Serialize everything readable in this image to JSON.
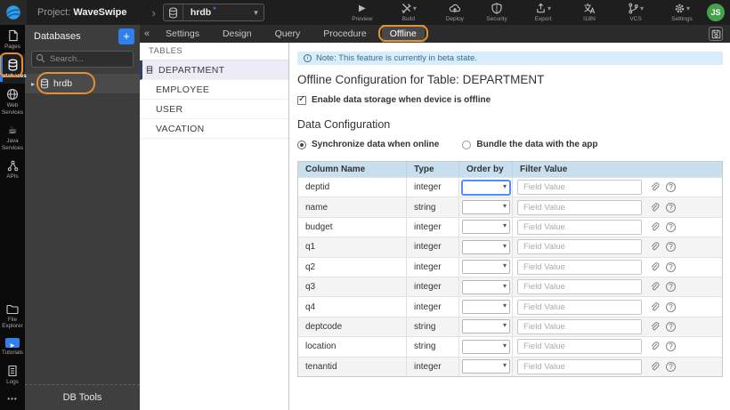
{
  "colors": {
    "accent_blue": "#2f80ed",
    "annotation_orange": "#e8902c",
    "note_bg": "#d9ecf9",
    "note_text": "#31708f",
    "table_header_bg": "#c8dff0",
    "avatar_green": "#46a24a",
    "active_tab_indicator": "#4a90e2"
  },
  "topbar": {
    "project_label": "Project:",
    "project_name": "WaveSwipe",
    "db_selector": {
      "value": "hrdb"
    },
    "actions_left": [
      {
        "label": "Preview",
        "icon": "play-icon"
      },
      {
        "label": "Build",
        "icon": "build-icon"
      },
      {
        "label": "Deploy",
        "icon": "deploy-icon"
      }
    ],
    "actions_right": [
      {
        "label": "Security",
        "icon": "shield-icon"
      },
      {
        "label": "Export",
        "icon": "export-icon"
      },
      {
        "label": "I18N",
        "icon": "translate-icon"
      },
      {
        "label": "VCS",
        "icon": "branch-icon"
      },
      {
        "label": "Settings",
        "icon": "gear-icon"
      }
    ],
    "avatar_initials": "JS"
  },
  "sidebar": {
    "top": [
      {
        "label": "Pages",
        "icon": "page-icon"
      },
      {
        "label": "Databases",
        "icon": "database-icon",
        "active": true
      },
      {
        "label": "Web Services",
        "icon": "globe-icon"
      },
      {
        "label": "Java Services",
        "icon": "coffee-icon"
      },
      {
        "label": "APIs",
        "icon": "api-icon"
      }
    ],
    "bottom": [
      {
        "label": "File Explorer",
        "icon": "folder-icon"
      },
      {
        "label": "Tutorials",
        "icon": "video-play-icon"
      },
      {
        "label": "Logs",
        "icon": "log-icon"
      }
    ]
  },
  "db_panel": {
    "title": "Databases",
    "search_placeholder": "Search...",
    "tree_items": [
      {
        "label": "hrdb"
      }
    ],
    "footer": "DB Tools"
  },
  "tabs": [
    {
      "label": "Settings"
    },
    {
      "label": "Design"
    },
    {
      "label": "Query"
    },
    {
      "label": "Procedure"
    },
    {
      "label": "Offline",
      "active": true
    }
  ],
  "tables_panel": {
    "header": "TABLES",
    "items": [
      "DEPARTMENT",
      "EMPLOYEE",
      "USER",
      "VACATION"
    ],
    "selected": "DEPARTMENT"
  },
  "main": {
    "note": "Note: This feature is currently in beta state.",
    "title": "Offline Configuration for Table: DEPARTMENT",
    "enable_checkbox_label": "Enable data storage when device is offline",
    "enable_checkbox_checked": true,
    "section_title": "Data Configuration",
    "radio_options": [
      {
        "label": "Synchronize data when online",
        "selected": true
      },
      {
        "label": "Bundle the data with the app",
        "selected": false
      }
    ],
    "config_table": {
      "headers": [
        "Column Name",
        "Type",
        "Order by",
        "Filter Value"
      ],
      "filter_placeholder": "Field Value",
      "rows": [
        {
          "name": "deptid",
          "type": "integer"
        },
        {
          "name": "name",
          "type": "string"
        },
        {
          "name": "budget",
          "type": "integer"
        },
        {
          "name": "q1",
          "type": "integer"
        },
        {
          "name": "q2",
          "type": "integer"
        },
        {
          "name": "q3",
          "type": "integer"
        },
        {
          "name": "q4",
          "type": "integer"
        },
        {
          "name": "deptcode",
          "type": "string"
        },
        {
          "name": "location",
          "type": "string"
        },
        {
          "name": "tenantid",
          "type": "integer"
        }
      ]
    }
  }
}
